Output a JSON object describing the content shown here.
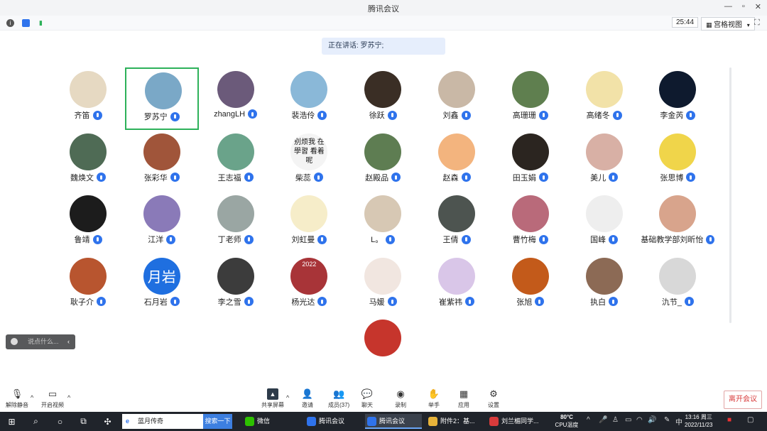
{
  "window": {
    "title": "腾讯会议",
    "controls": [
      "—",
      "▫",
      "✕"
    ]
  },
  "status": {
    "timer": "25:44",
    "view_label": "宫格视图",
    "view_caret": "▾",
    "fullscreen": "⛶"
  },
  "speaking": "正在讲话: 罗苏宁;",
  "participants": [
    {
      "name": "齐笛",
      "bg": "#e6d9c2"
    },
    {
      "name": "罗苏宁",
      "bg": "#7aa8c7",
      "active": true
    },
    {
      "name": "zhangLH",
      "bg": "#6b5a7a"
    },
    {
      "name": "裴浩伶",
      "bg": "#8ab8d8"
    },
    {
      "name": "徐跃",
      "bg": "#3a2e25"
    },
    {
      "name": "刘鑫",
      "bg": "#c9b8a6"
    },
    {
      "name": "高珊珊",
      "bg": "#5f7f4f"
    },
    {
      "name": "高绪冬",
      "bg": "#f2e2a8"
    },
    {
      "name": "李金芮",
      "bg": "#0e1a2e"
    },
    {
      "name": "魏焕文",
      "bg": "#4f6b55"
    },
    {
      "name": "张彩华",
      "bg": "#a0553a"
    },
    {
      "name": "王志福",
      "bg": "#6aa38a"
    },
    {
      "name": "柴蕊",
      "bg": "#f4f4f4",
      "text": "别烦我 在學習 看着呢"
    },
    {
      "name": "赵殿品",
      "bg": "#5e7d52"
    },
    {
      "name": "赵森",
      "bg": "#f3b47e"
    },
    {
      "name": "田玉娟",
      "bg": "#2b2520"
    },
    {
      "name": "美儿",
      "bg": "#d8b0a5"
    },
    {
      "name": "张思博",
      "bg": "#f0d54a"
    },
    {
      "name": "鲁靖",
      "bg": "#1c1c1c"
    },
    {
      "name": "江洋",
      "bg": "#8a7ab8"
    },
    {
      "name": "丁老师",
      "bg": "#9aa6a3"
    },
    {
      "name": "刘虹曼",
      "bg": "#f6edc9"
    },
    {
      "name": "L。",
      "bg": "#d7c8b4"
    },
    {
      "name": "王倩",
      "bg": "#4d5450"
    },
    {
      "name": "曹竹梅",
      "bg": "#b96a7a"
    },
    {
      "name": "国峰",
      "bg": "#eeeeee"
    },
    {
      "name": "基础教学部刘昕怡",
      "bg": "#d8a48c"
    },
    {
      "name": "耿子介",
      "bg": "#b8552f"
    },
    {
      "name": "石月岩",
      "bg": "#1f6fe0",
      "text": "月岩"
    },
    {
      "name": "李之雪",
      "bg": "#3c3c3c"
    },
    {
      "name": "杨光达",
      "bg": "#a83438",
      "text": "2022"
    },
    {
      "name": "马媛",
      "bg": "#f1e6e0"
    },
    {
      "name": "崔紫祎",
      "bg": "#d9c6e8"
    },
    {
      "name": "张旭",
      "bg": "#c35a1a"
    },
    {
      "name": "执白",
      "bg": "#8c6a55"
    },
    {
      "name": "氿节_",
      "bg": "#d8d8d8"
    },
    {
      "name": "",
      "bg": "#c6352c"
    }
  ],
  "chat": {
    "placeholder": "说点什么...",
    "arrow": "‹"
  },
  "toolbar": {
    "mute": "解除静音",
    "video": "开启视频",
    "share": "共享屏幕",
    "invite": "邀请",
    "members": "成员(37)",
    "chat": "聊天",
    "record": "录制",
    "raise_hand": "举手",
    "apps": "应用",
    "settings": "设置",
    "leave": "离开会议"
  },
  "taskbar": {
    "search_text": "蓝月传奇",
    "search_btn": "搜索一下",
    "apps": [
      {
        "label": "微信",
        "color": "#2dc100"
      },
      {
        "label": "腾讯会议",
        "color": "#2f73ec"
      },
      {
        "label": "腾讯会议",
        "color": "#2f73ec",
        "active": true
      },
      {
        "label": "附件2：基...",
        "color": "#e7b33a"
      },
      {
        "label": "刘兰楣同学...",
        "color": "#d83b3b"
      }
    ],
    "temp": "80°C",
    "temp_label": "CPU温度",
    "lang": "中",
    "time": "13:16 周三",
    "date": "2022/11/23"
  }
}
